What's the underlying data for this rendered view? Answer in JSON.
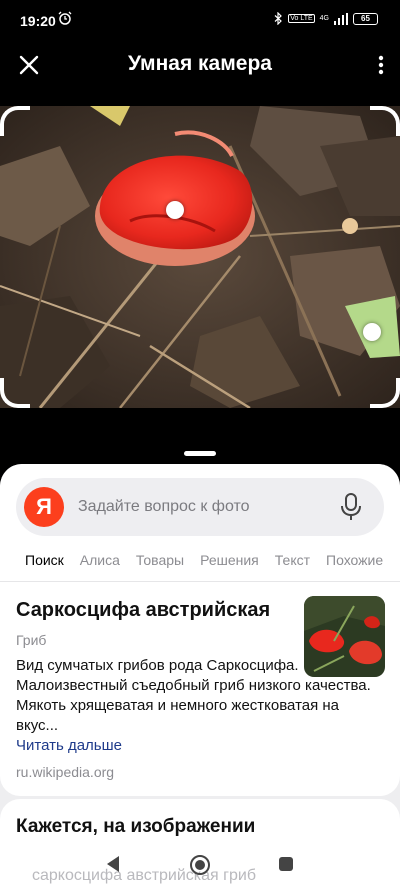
{
  "status_bar": {
    "time": "19:20",
    "lte": "Vo LTE",
    "network": "4G",
    "battery": "65"
  },
  "header": {
    "title": "Умная камера"
  },
  "search": {
    "logo": "Я",
    "placeholder": "Задайте вопрос к фото"
  },
  "tabs": [
    {
      "label": "Поиск",
      "active": true
    },
    {
      "label": "Алиса"
    },
    {
      "label": "Товары"
    },
    {
      "label": "Решения"
    },
    {
      "label": "Текст"
    },
    {
      "label": "Похожие"
    }
  ],
  "result": {
    "title": "Саркосцифа австрийская",
    "type": "Гриб",
    "description": "Вид сумчатых грибов рода Саркосцифа. Малоизвестный съедобный гриб низкого качества. Мякоть хрящеватая и немного жестковатая на вкус...",
    "read_more": "Читать дальше",
    "source": "ru.wikipedia.org"
  },
  "section2": {
    "title": "Кажется, на изображении",
    "item": "саркосцифа австрийская гриб"
  },
  "colors": {
    "accent": "#fc3f1d",
    "link": "#1e3a8a",
    "mushroom_red": "#e8281e"
  },
  "icons": {
    "close": "close-icon",
    "more": "more-vertical-icon",
    "mic": "microphone-icon",
    "back": "nav-back-icon",
    "home": "nav-home-icon",
    "recent": "nav-recent-icon"
  }
}
